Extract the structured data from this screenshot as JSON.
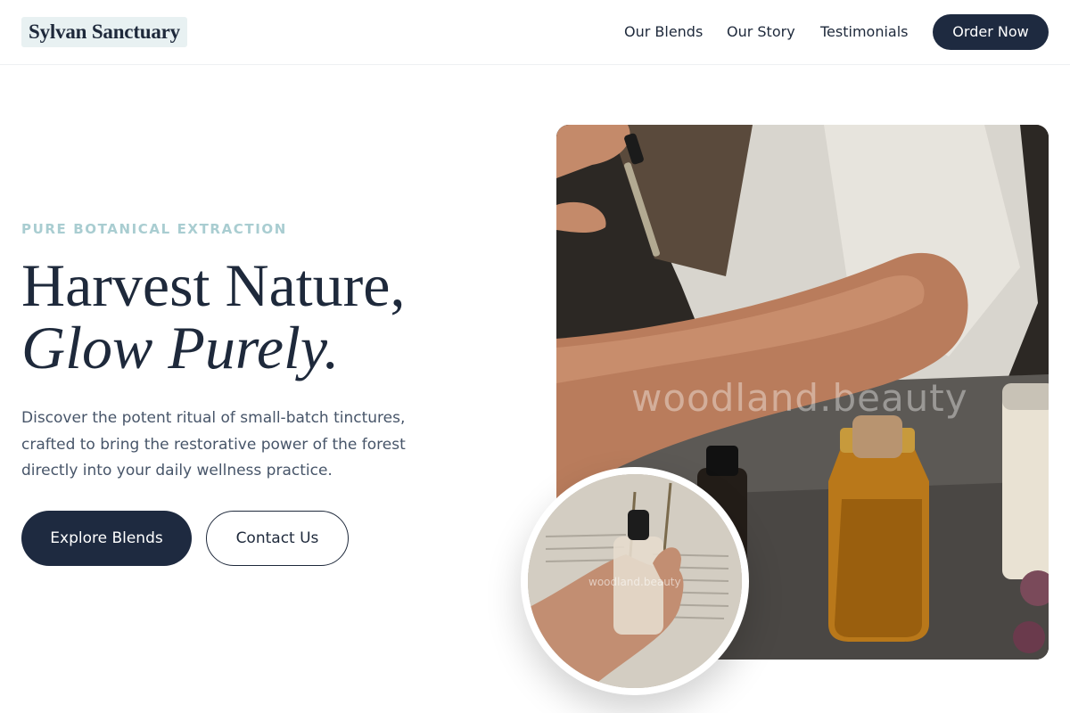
{
  "header": {
    "brand": "Sylvan Sanctuary",
    "nav": [
      "Our Blends",
      "Our Story",
      "Testimonials"
    ],
    "cta": "Order Now"
  },
  "hero": {
    "eyebrow": "PURE BOTANICAL EXTRACTION",
    "headline_line1": "Harvest Nature,",
    "headline_line2": "Glow Purely.",
    "subtext": "Discover the potent ritual of small-batch tinctures, crafted to bring the restorative power of the forest directly into your daily wellness practice.",
    "primary_button": "Explore Blends",
    "secondary_button": "Contact Us"
  },
  "images": {
    "main_watermark": "woodland.beauty",
    "inset_watermark": "woodland.beauty"
  },
  "colors": {
    "primary": "#1e2a40",
    "eyebrow": "#a9cdd1",
    "brand_bg": "#e8f1f2"
  }
}
